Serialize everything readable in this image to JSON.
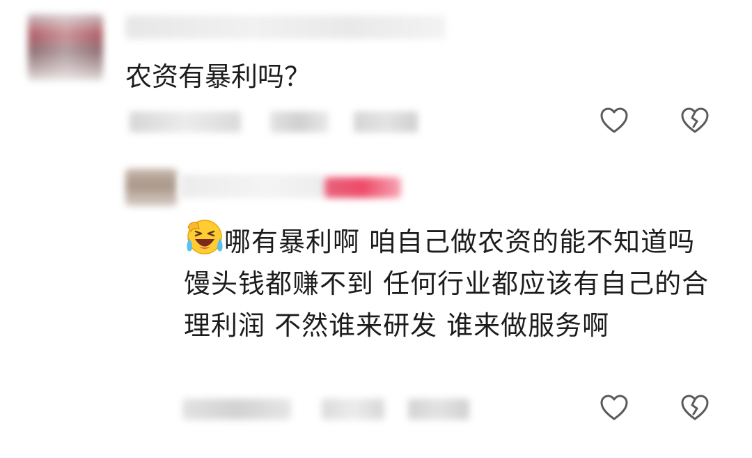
{
  "comment": {
    "text": "农资有暴利吗？",
    "like_icon": "heart-outline-icon",
    "dislike_icon": "broken-heart-icon"
  },
  "reply": {
    "emoji_icon": "laughing-tears-emoji-icon",
    "text": "哪有暴利啊 咱自己做农资的能不知道吗 馒头钱都赚不到 任何行业都应该有自己的合理利润 不然谁来研发 谁来做服务啊",
    "like_icon": "heart-outline-icon",
    "dislike_icon": "broken-heart-icon"
  },
  "colors": {
    "text": "#1c1c1c",
    "icon": "#5a5a5a",
    "badge": "#ee4b68"
  }
}
